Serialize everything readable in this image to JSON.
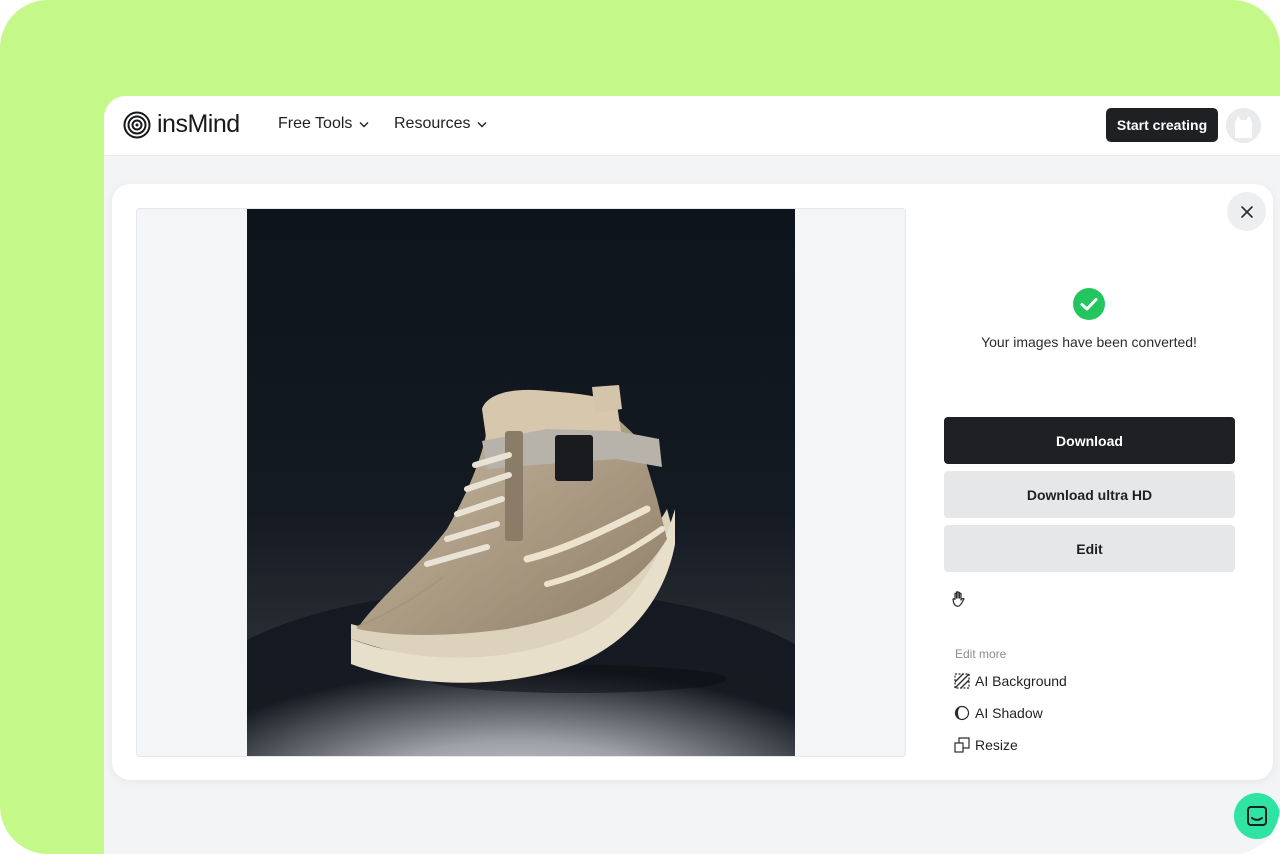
{
  "brand": {
    "name": "insMind"
  },
  "nav": {
    "items": [
      {
        "label": "Free Tools"
      },
      {
        "label": "Resources"
      }
    ],
    "cta": "Start creating"
  },
  "result": {
    "status_text": "Your images have been converted!",
    "buttons": {
      "download": "Download",
      "download_hd": "Download ultra HD",
      "edit": "Edit"
    },
    "edit_more": {
      "heading": "Edit more",
      "tools": [
        {
          "label": "AI Background",
          "icon": "ai-background-icon"
        },
        {
          "label": "AI Shadow",
          "icon": "ai-shadow-icon"
        },
        {
          "label": "Resize",
          "icon": "resize-icon"
        }
      ]
    }
  },
  "colors": {
    "frame": "#c4f98a",
    "accent_dark": "#1f2023",
    "success": "#22c55e",
    "chat": "#2fe3a3"
  }
}
